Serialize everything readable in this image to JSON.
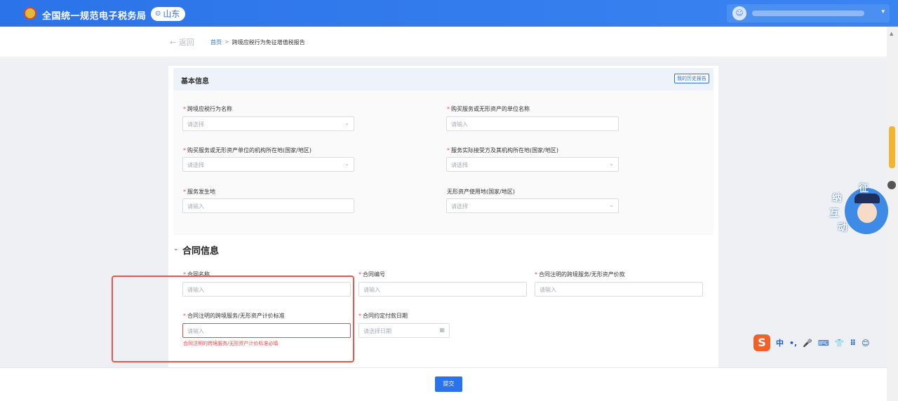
{
  "header": {
    "title": "全国统一规范电子税务局",
    "region": "山东",
    "user_caret": "▾"
  },
  "breadcrumb": {
    "back": "← 返回",
    "home": "首页",
    "separator": ">",
    "current": "跨境应税行为免征增值税报告"
  },
  "basic_info": {
    "title": "基本信息",
    "history_button": "我的历史报告",
    "fields": {
      "cross_border_name": {
        "label": "跨境应税行为名称",
        "placeholder": "请选择",
        "required": true
      },
      "buyer_name": {
        "label": "购买服务或无形资产的单位名称",
        "placeholder": "请输入",
        "required": true
      },
      "buyer_location": {
        "label": "购买服务或无形资产单位的机构所在地(国家/地区)",
        "placeholder": "请选择",
        "required": true
      },
      "receiver_location": {
        "label": "服务实际接受方及其机构所在地(国家/地区)",
        "placeholder": "请选择",
        "required": true
      },
      "service_place": {
        "label": "服务发生地",
        "placeholder": "请输入",
        "required": true
      },
      "intangible_use_place": {
        "label": "无形资产使用地(国家/地区)",
        "placeholder": "请选择",
        "required": false
      }
    }
  },
  "contract_info": {
    "title": "合同信息",
    "collapse": "⌄",
    "fields": {
      "contract_name": {
        "label": "合同名称",
        "placeholder": "请输入",
        "required": true
      },
      "contract_no": {
        "label": "合同编号",
        "placeholder": "请输入",
        "required": true
      },
      "contract_price": {
        "label": "合同注明的跨境服务/无形资产价款",
        "placeholder": "请输入",
        "required": true
      },
      "pricing_standard": {
        "label": "合同注明的跨境服务/无形资产计价标准",
        "placeholder": "请输入",
        "required": true,
        "error": "合同注明的跨境服务/无形资产计价标准必填"
      },
      "payment_date": {
        "label": "合同约定付款日期",
        "placeholder": "请选择日期",
        "required": true
      }
    }
  },
  "footer": {
    "submit": "提交"
  },
  "mascot": {
    "chars": [
      "征",
      "纳",
      "互",
      "动"
    ]
  },
  "ime": {
    "logo": "S",
    "items": [
      "中",
      "•,",
      "🎤",
      "⌨",
      "👕",
      "⠿",
      "😊"
    ]
  },
  "colors": {
    "primary": "#2b73e8",
    "error": "#e34d4d",
    "highlight": "#e05a4f"
  }
}
